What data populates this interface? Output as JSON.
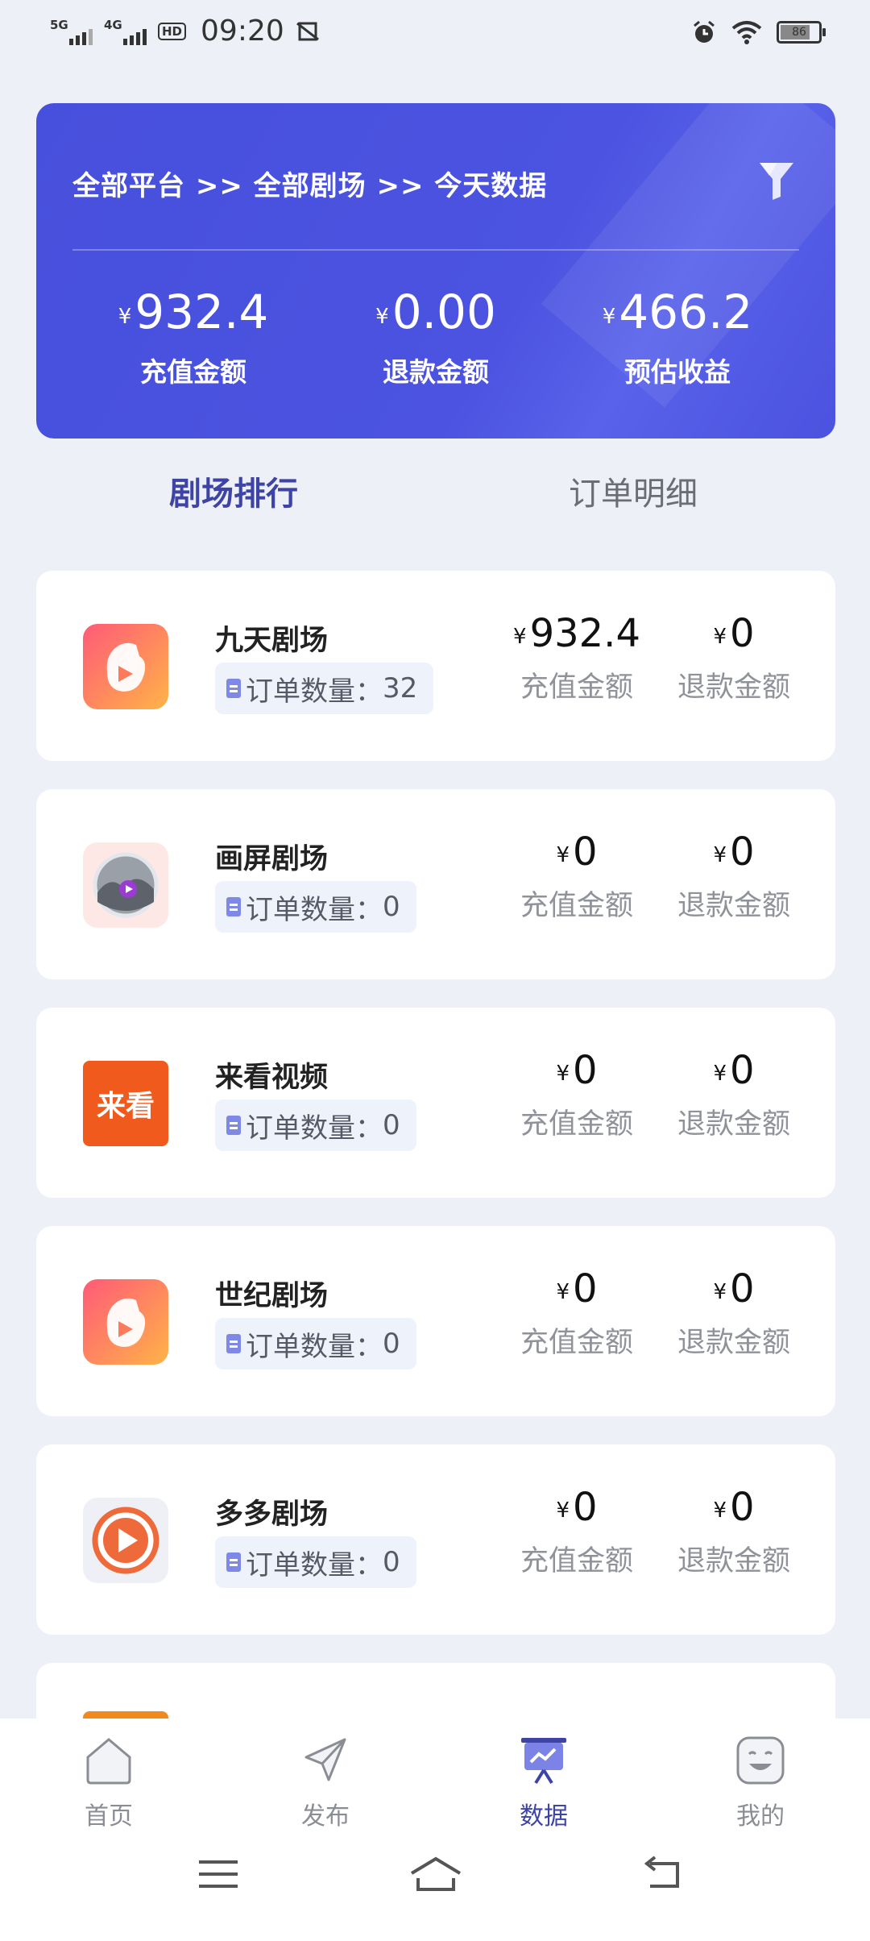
{
  "status_bar": {
    "net1": "5G",
    "net2": "4G",
    "hd": "HD",
    "time": "09:20",
    "battery": "86"
  },
  "hero": {
    "breadcrumb": "全部平台 >> 全部剧场 >> 今天数据",
    "currency": "¥",
    "stats": [
      {
        "value": "932.4",
        "label": "充值金额"
      },
      {
        "value": "0.00",
        "label": "退款金额"
      },
      {
        "value": "466.2",
        "label": "预估收益"
      }
    ],
    "bg_color": "#4750dc"
  },
  "tabs": [
    {
      "label": "剧场排行",
      "active": true
    },
    {
      "label": "订单明细",
      "active": false
    }
  ],
  "list": {
    "currency": "¥",
    "order_prefix": "订单数量：",
    "recharge_label": "充值金额",
    "refund_label": "退款金额",
    "items": [
      {
        "name": "九天剧场",
        "orders": "32",
        "recharge": "932.4",
        "refund": "0",
        "logo": "jiutian-logo"
      },
      {
        "name": "画屏剧场",
        "orders": "0",
        "recharge": "0",
        "refund": "0",
        "logo": "huaping-logo"
      },
      {
        "name": "来看视频",
        "orders": "0",
        "recharge": "0",
        "refund": "0",
        "logo": "laikan-logo",
        "logo_text": "来看"
      },
      {
        "name": "世纪剧场",
        "orders": "0",
        "recharge": "0",
        "refund": "0",
        "logo": "shiji-logo"
      },
      {
        "name": "多多剧场",
        "orders": "0",
        "recharge": "0",
        "refund": "0",
        "logo": "duoduo-logo"
      }
    ]
  },
  "bottom_nav": [
    {
      "label": "首页",
      "icon": "home-icon",
      "active": false
    },
    {
      "label": "发布",
      "icon": "send-icon",
      "active": false
    },
    {
      "label": "数据",
      "icon": "chart-board-icon",
      "active": true
    },
    {
      "label": "我的",
      "icon": "smile-face-icon",
      "active": false
    }
  ],
  "accent_color": "#3d44a6"
}
